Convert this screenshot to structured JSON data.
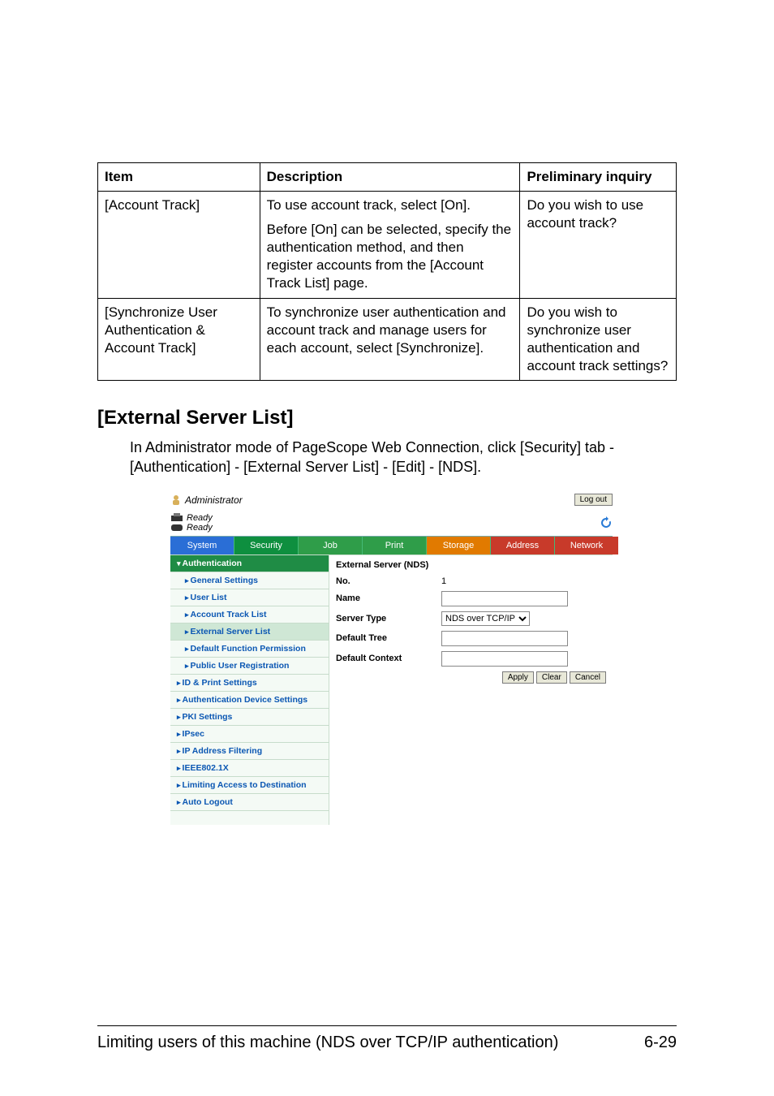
{
  "table": {
    "head": {
      "item": "Item",
      "desc": "Description",
      "inq": "Preliminary inquiry"
    },
    "rows": {
      "r1": {
        "item": "[Account Track]",
        "desc1": "To use account track, select [On].",
        "desc2": "Before [On] can be selected, specify the authentication method, and then register accounts from the [Account Track List] page.",
        "inq": "Do you wish to use account track?"
      },
      "r2": {
        "item": "[Synchronize User Authentication & Account Track]",
        "desc": "To synchronize user authentication and account track and manage users for each account, select [Synchronize].",
        "inq": "Do you wish to synchronize user authentication and account track settings?"
      }
    }
  },
  "section": {
    "heading": "[External Server List]",
    "para": "In Administrator mode of PageScope Web Connection, click [Security] tab - [Authentication] - [External Server List] - [Edit] - [NDS]."
  },
  "shot": {
    "header_title": "Administrator",
    "ready1": "Ready",
    "ready2": "Ready",
    "logout": "Log out",
    "tabs": {
      "system": "System",
      "security": "Security",
      "job": "Job",
      "print": "Print",
      "storage": "Storage",
      "address": "Address",
      "network": "Network"
    },
    "sidebar": {
      "auth": "Authentication",
      "general": "General Settings",
      "userlist": "User List",
      "acct": "Account Track List",
      "extlist": "External Server List",
      "defperm": "Default Function Permission",
      "pubreg": "Public User Registration",
      "idprint": "ID & Print Settings",
      "authdev": "Authentication Device Settings",
      "pki": "PKI Settings",
      "ipsec": "IPsec",
      "ipfilt": "IP Address Filtering",
      "ieee": "IEEE802.1X",
      "limit": "Limiting Access to Destination",
      "autolog": "Auto Logout"
    },
    "main": {
      "title": "External Server (NDS)",
      "no_lab": "No.",
      "no_val": "1",
      "name_lab": "Name",
      "stype_lab": "Server Type",
      "stype_val": "NDS over TCP/IP",
      "deftree_lab": "Default Tree",
      "defctx_lab": "Default Context",
      "apply": "Apply",
      "clear": "Clear",
      "cancel": "Cancel"
    }
  },
  "footer": {
    "text": "Limiting users of this machine (NDS over TCP/IP authentication)",
    "page": "6-29"
  }
}
